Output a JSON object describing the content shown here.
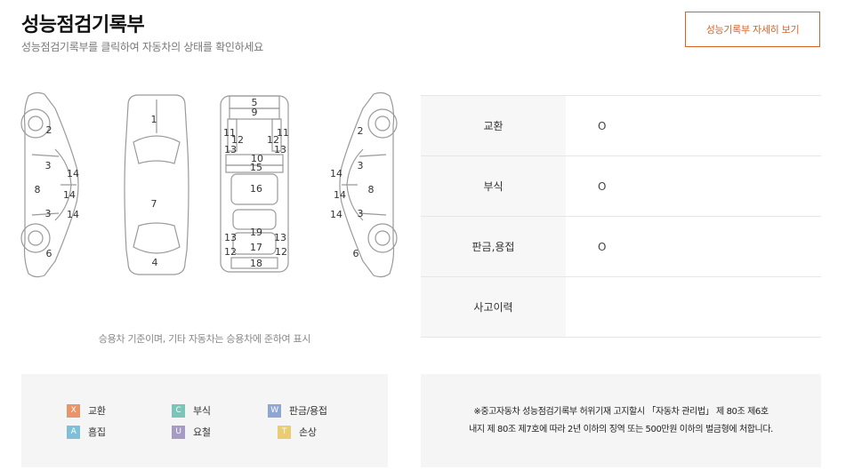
{
  "header": {
    "title": "성능점검기록부",
    "subtitle": "성능점검기록부를 클릭하여 자동차의 상태를 확인하세요",
    "detail_button": "성능기록부 자세히 보기"
  },
  "diagram": {
    "left_side_numbers": [
      "2",
      "3",
      "14",
      "8",
      "14",
      "3",
      "14",
      "6"
    ],
    "top_view_numbers": [
      "1",
      "7",
      "4"
    ],
    "frame_numbers": [
      "5",
      "9",
      "11",
      "12",
      "13",
      "11",
      "12",
      "13",
      "10",
      "15",
      "16",
      "19",
      "13",
      "17",
      "13",
      "12",
      "12",
      "18"
    ],
    "right_side_numbers": [
      "2",
      "14",
      "3",
      "14",
      "8",
      "14",
      "3",
      "6"
    ],
    "note": "승용차 기준이며, 기타 자동차는 승용차에 준하여 표시"
  },
  "status": [
    {
      "label": "교환",
      "value": "O"
    },
    {
      "label": "부식",
      "value": "O"
    },
    {
      "label": "판금,용접",
      "value": "O"
    },
    {
      "label": "사고이력",
      "value": ""
    }
  ],
  "legend": [
    {
      "code": "X",
      "label": "교환",
      "color": "#e8956b"
    },
    {
      "code": "C",
      "label": "부식",
      "color": "#7cc3b8"
    },
    {
      "code": "W",
      "label": "판금/용접",
      "color": "#8ea7d2"
    },
    {
      "code": "A",
      "label": "흠집",
      "color": "#7fc0d8"
    },
    {
      "code": "U",
      "label": "요철",
      "color": "#a69bc4"
    },
    {
      "code": "T",
      "label": "손상",
      "color": "#e8cd72"
    }
  ],
  "warning": {
    "line1": "※중고자동차 성능점검기록부 허위기재 고지할시 「자동차 관리법」 제 80조 제6호",
    "line2": "내지 제 80조 제7호에 따라 2년 이하의 징역 또는 500만원 이하의 벌금형에 처합니다."
  }
}
